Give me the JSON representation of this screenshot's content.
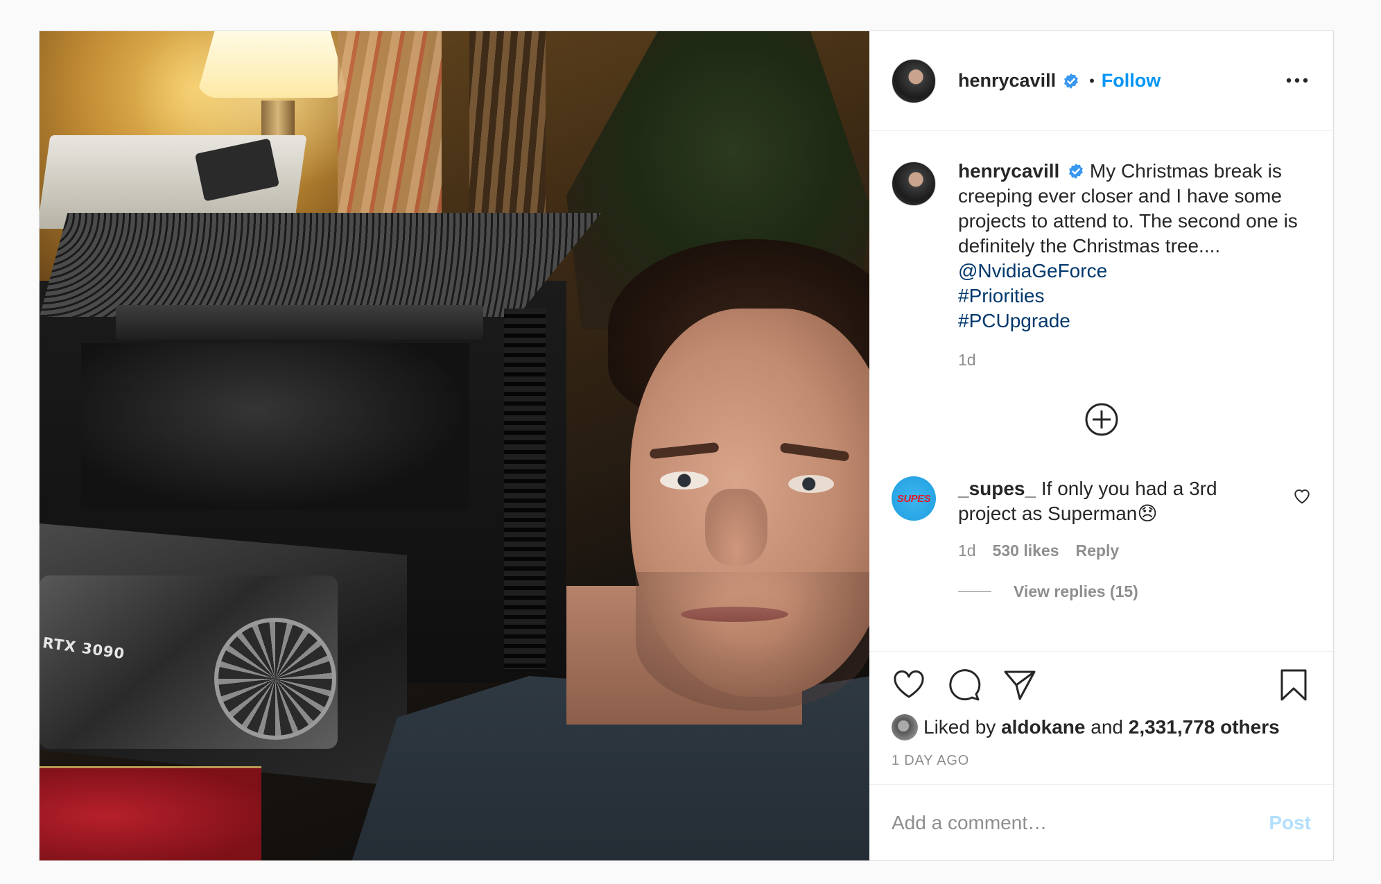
{
  "photo": {
    "gpu_label": "RTX 3090"
  },
  "header": {
    "username": "henrycavill",
    "separator": "•",
    "follow_label": "Follow"
  },
  "caption": {
    "username": "henrycavill",
    "text": "My Christmas break is creeping ever closer and I have some projects to attend to. The second one is definitely the Christmas tree....",
    "mention": "@NvidiaGeForce",
    "hashtags": [
      "#Priorities",
      "#PCUpgrade"
    ],
    "time": "1d"
  },
  "comment": {
    "avatar_text": "SUPES",
    "username": "_supes_",
    "text": "If only you had a 3rd project as Superman😞",
    "time": "1d",
    "likes": "530 likes",
    "reply_label": "Reply",
    "view_replies": "View replies (15)"
  },
  "likes": {
    "prefix": "Liked by",
    "user": "aldokane",
    "conjunction": "and",
    "others": "2,331,778 others"
  },
  "timestamp": "1 DAY AGO",
  "add_comment": {
    "placeholder": "Add a comment…",
    "post_label": "Post"
  },
  "colors": {
    "follow": "#0095f6",
    "link": "#00376b",
    "verified": "#3897f0",
    "post_disabled": "#b2dffc",
    "muted": "#8e8e8e"
  },
  "icons": [
    "verified-badge-icon",
    "more-options-icon",
    "load-more-icon",
    "heart-icon",
    "comment-icon",
    "share-icon",
    "bookmark-icon"
  ]
}
